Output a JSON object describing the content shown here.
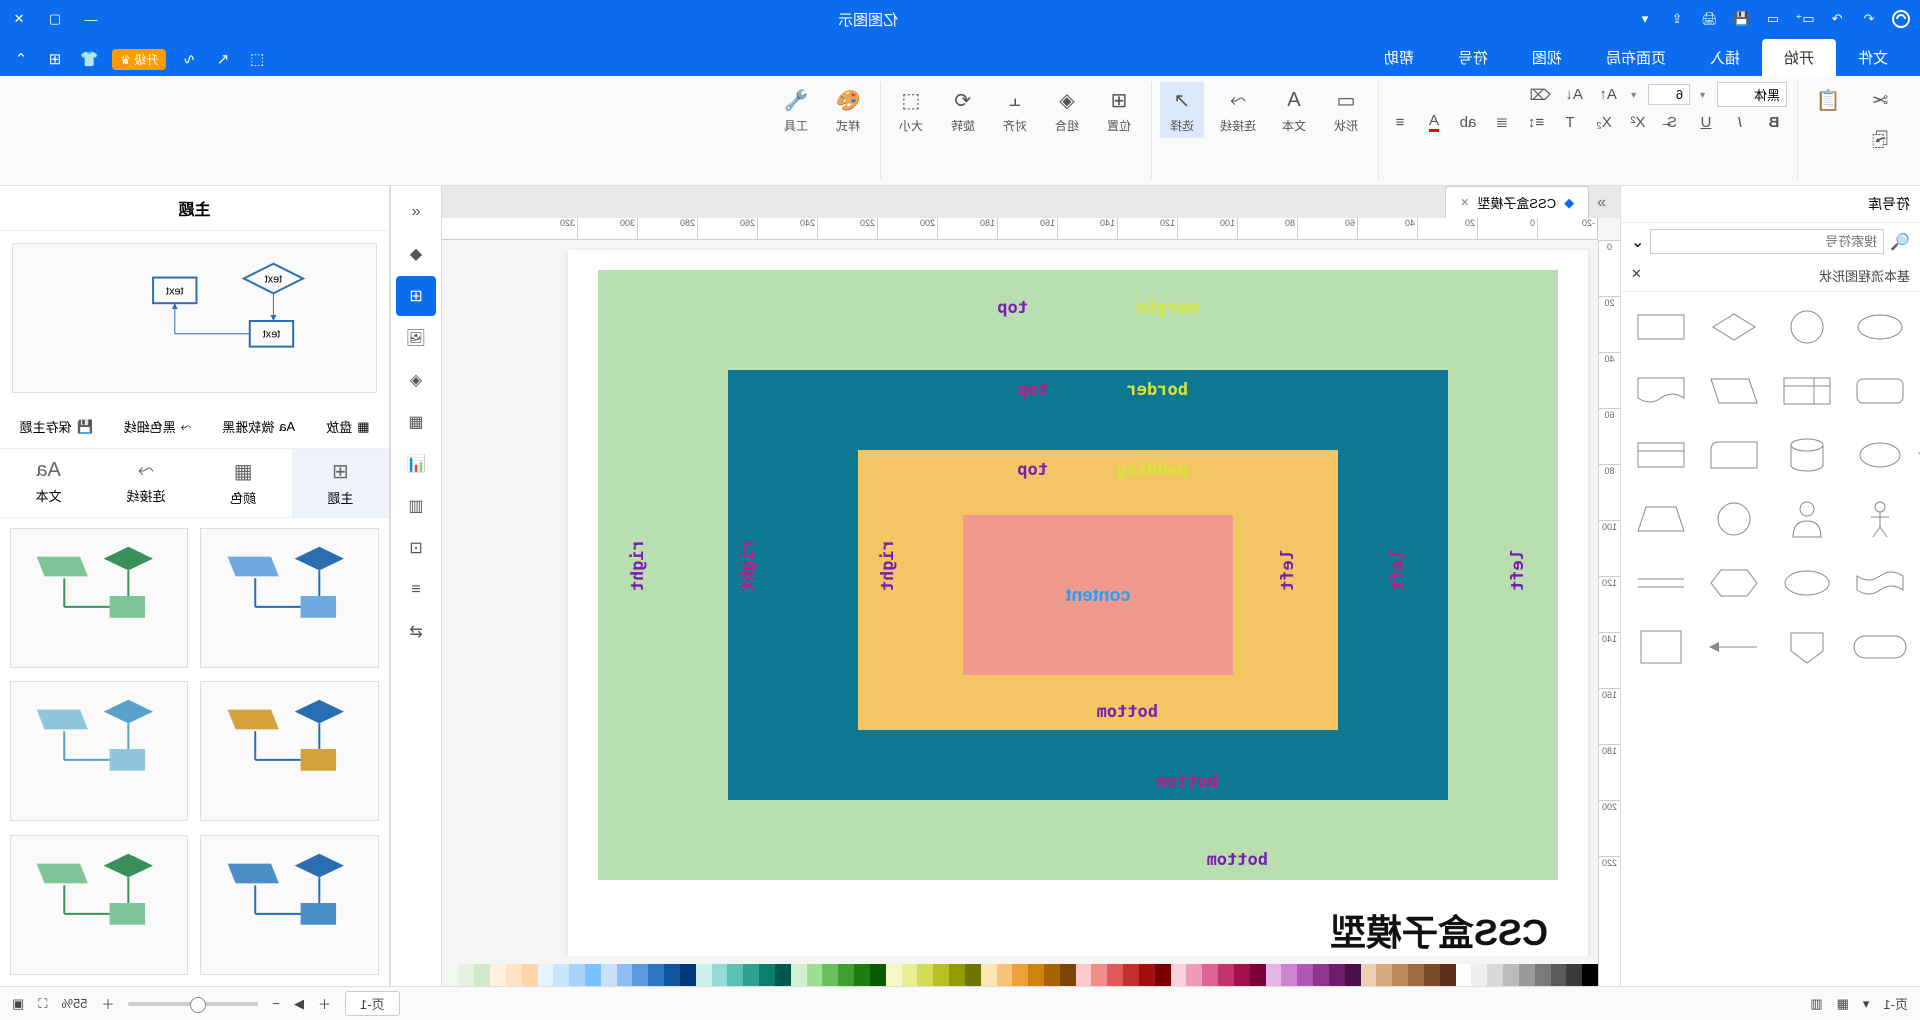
{
  "app": {
    "title": "亿图图示"
  },
  "menu": {
    "tabs": [
      "文件",
      "开始",
      "插入",
      "页面布局",
      "视图",
      "符号",
      "帮助"
    ],
    "active": 1,
    "upgrade_label": "升级"
  },
  "ribbon": {
    "font_family": "黑体",
    "font_size": "6",
    "items": {
      "paste": "粘贴",
      "copy": "复制",
      "cut": "剪切",
      "bold": "B",
      "italic": "I",
      "underline": "U",
      "shape": "形状",
      "text": "文本",
      "connector": "连接线",
      "select": "选择",
      "position": "位置",
      "combine": "组合",
      "align": "对齐",
      "rotate": "旋转",
      "size": "大小",
      "style": "样式",
      "tools": "工具"
    }
  },
  "shapes_panel": {
    "title": "符号库",
    "search_placeholder": "搜索符号",
    "category": "基本流程图形状"
  },
  "doc_tab": {
    "title": "CSS盒子模型"
  },
  "ruler_h": [
    "-20",
    "0",
    "20",
    "40",
    "60",
    "80",
    "100",
    "120",
    "140",
    "160",
    "180",
    "200",
    "220",
    "240",
    "260",
    "280",
    "300",
    "320"
  ],
  "ruler_v": [
    "0",
    "20",
    "40",
    "60",
    "80",
    "100",
    "120",
    "140",
    "160",
    "180",
    "200",
    "220"
  ],
  "boxmodel": {
    "title": "CSS盒子模型",
    "margin": "margin",
    "border": "border",
    "padding": "padding",
    "content": "content",
    "top": "top",
    "bottom": "bottom",
    "left": "left",
    "right": "right"
  },
  "colors": [
    "#000",
    "#3b3b3b",
    "#5a5a5a",
    "#7a7a7a",
    "#9a9a9a",
    "#bcbcbc",
    "#d8d8d8",
    "#efefef",
    "#fff",
    "#5b2f18",
    "#7a4a2a",
    "#9e6a3f",
    "#bb8a5d",
    "#d7ab81",
    "#ecd0b0",
    "#4b0f4a",
    "#6e1d6a",
    "#8f3590",
    "#af57b2",
    "#cd83d0",
    "#e5b5e6",
    "#7a003a",
    "#a0114e",
    "#c43469",
    "#df6390",
    "#f09bb8",
    "#fcd0df",
    "#7a0000",
    "#a01010",
    "#c43030",
    "#df5a5a",
    "#f08e8e",
    "#fccaca",
    "#7a4500",
    "#a86200",
    "#d08210",
    "#eaa23b",
    "#f8c576",
    "#ffe4b5",
    "#6e7400",
    "#949b00",
    "#b8c022",
    "#d4db55",
    "#e9ee93",
    "#f6f8c9",
    "#0a5a00",
    "#1c7d10",
    "#3e9f30",
    "#6bc05d",
    "#a0dc94",
    "#d3f0cd",
    "#005a4c",
    "#0d7d6d",
    "#2f9f90",
    "#5cc0b4",
    "#93dcd3",
    "#cdf0ec",
    "#003a7a",
    "#0f56a0",
    "#3076c4",
    "#5b99df",
    "#90bdf0",
    "#cadffc",
    "#7ac2ff",
    "#a6d6ff",
    "#c9e6ff",
    "#e6f2ff",
    "#ffd4a6",
    "#ffe3c4",
    "#fff0e0",
    "#cfe9c9",
    "#e3f3df",
    "#f2faf0"
  ],
  "side_tools": [
    "展开",
    "填充",
    "形状库",
    "图片",
    "图层",
    "表格",
    "图表",
    "表",
    "公式",
    "关系",
    "对齐"
  ],
  "theme": {
    "title": "主题",
    "opts": [
      "盘放",
      "微软雅黑",
      "黑色细线",
      "保存主题"
    ],
    "subtabs": [
      "主题",
      "颜色",
      "连接线",
      "文本"
    ]
  },
  "status": {
    "page_label": "页-1",
    "page_tab": "页-1",
    "zoom": "55%"
  }
}
